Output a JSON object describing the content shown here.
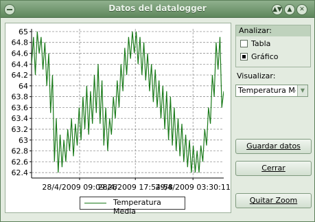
{
  "window": {
    "title": "Datos del datalogger"
  },
  "analizar": {
    "title": "Analizar:",
    "options": [
      {
        "label": "Tabla",
        "selected": false
      },
      {
        "label": "Gráfico",
        "selected": true
      }
    ]
  },
  "visualizar": {
    "label": "Visualizar:",
    "selected": "Temperatura Media"
  },
  "buttons": {
    "guardar": "Guardar datos",
    "cerrar": "Cerrar",
    "quitar_zoom": "Quitar Zoom"
  },
  "colors": {
    "series": "#1a7a1a",
    "grid": "#808080"
  },
  "chart_data": {
    "type": "line",
    "title": "",
    "xlabel": "",
    "ylabel": "",
    "grid": true,
    "legend": "bottom-center",
    "ylim": [
      62.3,
      65.05
    ],
    "yticks": [
      62.4,
      62.6,
      62.8,
      63,
      63.2,
      63.4,
      63.6,
      63.8,
      64,
      64.2,
      64.4,
      64.6,
      64.8,
      65
    ],
    "xtick_labels": [
      "28/4/2009 09:09:26",
      "28/4/2009 17:54:58",
      "29/4/2009 03:30:11"
    ],
    "xtick_positions": [
      0.25,
      0.54,
      0.84
    ],
    "series": [
      {
        "name": "Temperatura Media",
        "values": [
          64.4,
          64.9,
          64.2,
          65.0,
          64.6,
          64.9,
          64.3,
          64.8,
          64.0,
          64.6,
          63.5,
          64.2,
          62.6,
          63.4,
          62.4,
          63.1,
          62.5,
          63.0,
          62.6,
          63.2,
          62.8,
          63.4,
          62.7,
          63.3,
          62.9,
          63.6,
          63.0,
          63.8,
          63.2,
          64.0,
          63.1,
          63.9,
          63.3,
          64.2,
          63.5,
          64.4,
          63.3,
          64.1,
          62.9,
          63.6,
          62.8,
          63.4,
          63.1,
          63.8,
          63.4,
          64.1,
          63.6,
          64.4,
          63.9,
          64.7,
          64.2,
          64.9,
          64.5,
          65.0,
          64.6,
          65.0,
          64.4,
          64.9,
          64.2,
          64.8,
          64.1,
          64.6,
          63.9,
          64.4,
          63.7,
          64.3,
          63.6,
          64.1,
          63.4,
          64.0,
          63.2,
          63.9,
          63.0,
          63.8,
          62.9,
          63.6,
          62.8,
          63.4,
          62.7,
          63.3,
          62.6,
          63.1,
          62.5,
          63.0,
          62.4,
          62.9,
          62.4,
          62.8,
          62.4,
          62.9,
          62.6,
          63.2,
          62.9,
          63.6,
          63.3,
          64.2,
          63.8,
          64.8,
          64.3,
          64.9,
          63.6,
          63.9
        ]
      }
    ]
  }
}
